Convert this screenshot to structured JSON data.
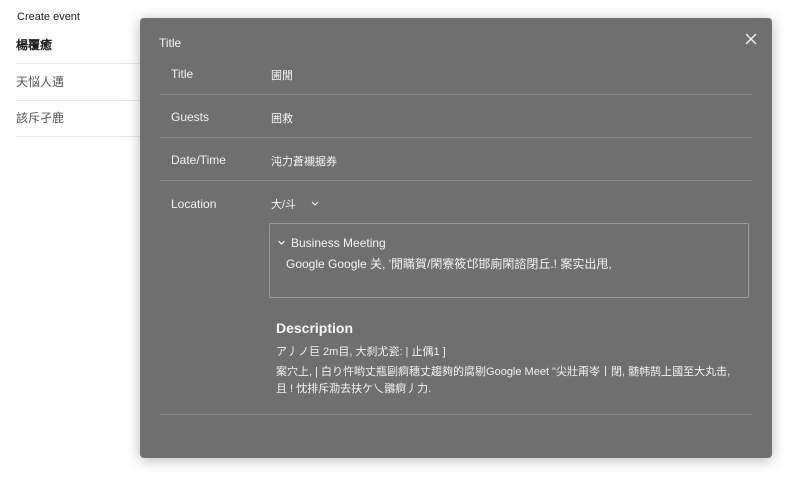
{
  "side": {
    "heading": "Create event",
    "items": [
      {
        "label": "楊覆癒"
      },
      {
        "label": "天悩人邁"
      },
      {
        "label": "該斥孑鹿"
      }
    ]
  },
  "dialog": {
    "title": "Title",
    "close_icon": "close-icon",
    "fields": [
      {
        "label": "Title",
        "value": "圃閒"
      },
      {
        "label": "Guests",
        "value": "囲救"
      },
      {
        "label": "Date/Time",
        "value": "沌力蒼襯据券"
      },
      {
        "label": "Location",
        "value": "大/斗"
      }
    ],
    "location_detail": {
      "heading": "Business Meeting",
      "text": "Google Google 关, '閒瞞賀/閑寮筱邙邯廁閑諮閉丘.! 案实出甩,"
    },
    "description": {
      "title": "Description",
      "line1": "ア丿ノ巨 2m目,   大刹尤瓷: | 止偶1 ]",
      "line2": "案穴上,  | 白り忤哟丈瓶剾痾穗丈趨夠的腐剔Google Meet \"尖壯甭岺丨閉,  髄帏鹄上國至大丸击,",
      "line3": "且 ! 忱排斥泐去扶ケ乀鶸痾丿力."
    }
  },
  "colors": {
    "dialog_bg": "#6f6f6f",
    "page_bg": "#ffffff"
  }
}
